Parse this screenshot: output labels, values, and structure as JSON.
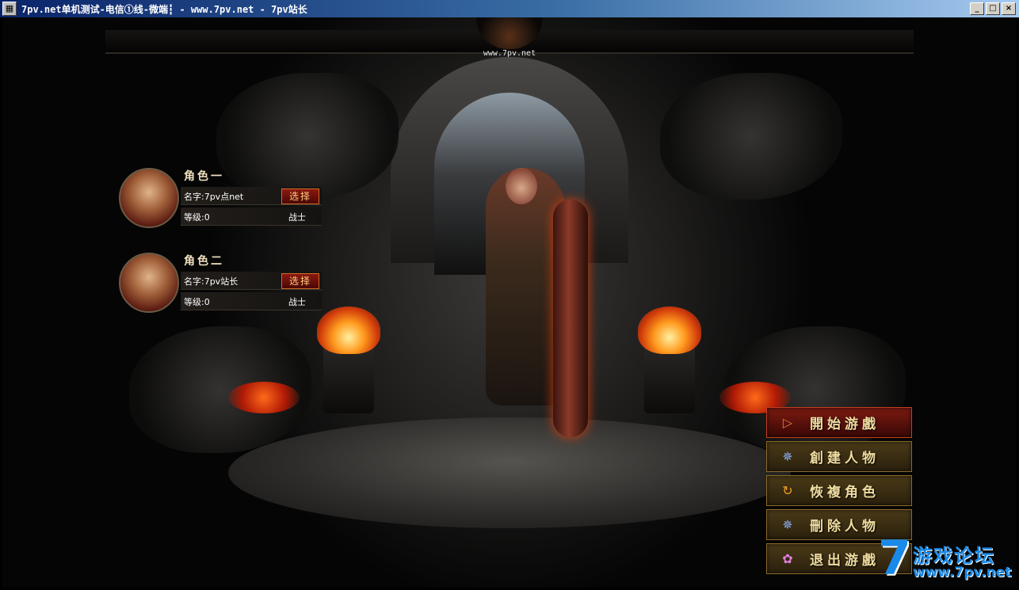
{
  "window": {
    "title": "7pv.net单机测试-电信①线-微端┇ - www.7pv.net - 7pv站长",
    "controls": {
      "minimize": "_",
      "maximize": "□",
      "close": "×"
    }
  },
  "scene": {
    "site_mark": "www.7pv.net"
  },
  "characters": [
    {
      "title": "角色一",
      "name": "名字:7pv点net",
      "level": "等级:0",
      "job": "战士",
      "select_label": "选择"
    },
    {
      "title": "角色二",
      "name": "名字:7pv站长",
      "level": "等级:0",
      "job": "战士",
      "select_label": "选择"
    }
  ],
  "menu": [
    {
      "label": "開始游戲",
      "icon": "play-arrow-icon"
    },
    {
      "label": "創建人物",
      "icon": "star-badge-icon"
    },
    {
      "label": "恢複角色",
      "icon": "swirl-icon"
    },
    {
      "label": "刪除人物",
      "icon": "star-badge-icon"
    },
    {
      "label": "退出游戲",
      "icon": "flower-icon"
    }
  ],
  "logo": {
    "seven": "7",
    "text": "游戏论坛",
    "url": "www.7pv.net"
  },
  "colors": {
    "accent_gold": "#f0dca0",
    "active_red": "#7a1a10",
    "logo_blue": "#1a8ae8"
  }
}
